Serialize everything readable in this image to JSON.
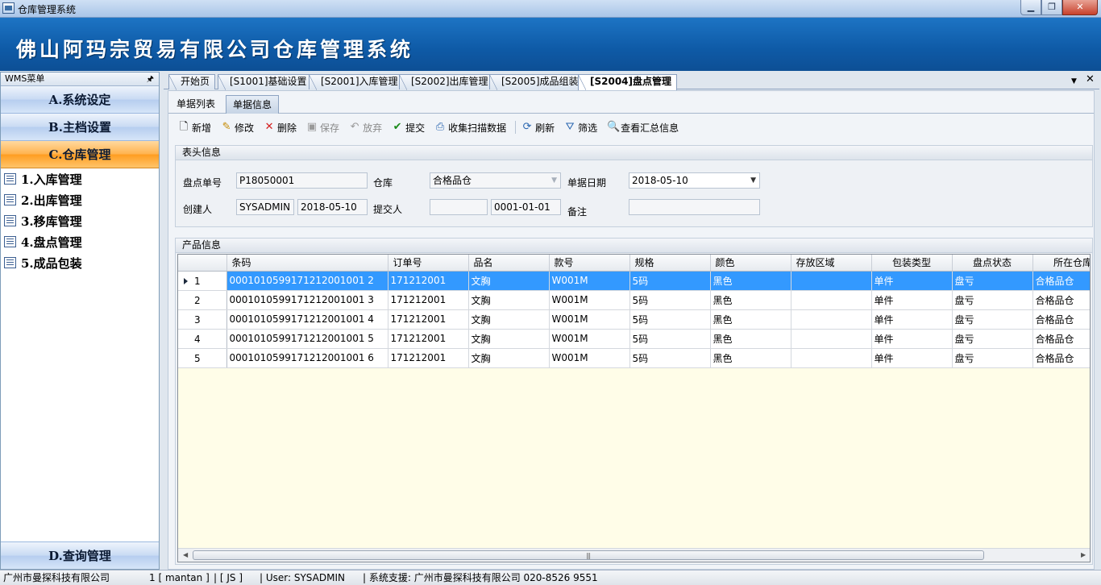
{
  "window": {
    "title": "仓库管理系统"
  },
  "banner": {
    "title": "佛山阿玛宗贸易有限公司仓库管理系统"
  },
  "sidebar": {
    "header": "WMS菜单",
    "groups": [
      {
        "label": "A.系统设定"
      },
      {
        "label": "B.主档设置"
      },
      {
        "label": "C.仓库管理"
      }
    ],
    "items": [
      {
        "label": "1.入库管理"
      },
      {
        "label": "2.出库管理"
      },
      {
        "label": "3.移库管理"
      },
      {
        "label": "4.盘点管理"
      },
      {
        "label": "5.成品包装"
      }
    ],
    "bottom_group": {
      "label": "D.查询管理"
    }
  },
  "doc_tabs": [
    {
      "label": "开始页"
    },
    {
      "label": "[S1001]基础设置"
    },
    {
      "label": "[S2001]入库管理"
    },
    {
      "label": "[S2002]出库管理"
    },
    {
      "label": "[S2005]成品组装"
    },
    {
      "label": "[S2004]盘点管理"
    }
  ],
  "sub_tabs": [
    {
      "label": "单据列表"
    },
    {
      "label": "单据信息"
    }
  ],
  "toolbar": {
    "add": "新增",
    "edit": "修改",
    "delete": "删除",
    "save": "保存",
    "discard": "放弃",
    "submit": "提交",
    "collect_scan": "收集扫描数据",
    "refresh": "刷新",
    "filter": "筛选",
    "summary": "查看汇总信息"
  },
  "header_section": {
    "title": "表头信息",
    "fields": {
      "doc_no_label": "盘点单号",
      "doc_no_value": "P18050001",
      "warehouse_label": "仓库",
      "warehouse_value": "合格品仓",
      "doc_date_label": "单据日期",
      "doc_date_value": "2018-05-10",
      "creator_label": "创建人",
      "creator_value": "SYSADMIN",
      "create_date_value": "2018-05-10",
      "submitter_label": "提交人",
      "submitter_value": "",
      "submit_date_value": "0001-01-01",
      "remark_label": "备注",
      "remark_value": ""
    }
  },
  "product_section": {
    "title": "产品信息",
    "columns": [
      "条码",
      "订单号",
      "品名",
      "款号",
      "规格",
      "颜色",
      "存放区域",
      "包装类型",
      "盘点状态",
      "所在仓库"
    ],
    "rows": [
      {
        "no": "1",
        "cells": [
          "0001010599171212001001 2",
          "171212001",
          "文胸",
          "W001M",
          "5码",
          "黑色",
          "",
          "单件",
          "盘亏",
          "合格品仓"
        ]
      },
      {
        "no": "2",
        "cells": [
          "0001010599171212001001 3",
          "171212001",
          "文胸",
          "W001M",
          "5码",
          "黑色",
          "",
          "单件",
          "盘亏",
          "合格品仓"
        ]
      },
      {
        "no": "3",
        "cells": [
          "0001010599171212001001 4",
          "171212001",
          "文胸",
          "W001M",
          "5码",
          "黑色",
          "",
          "单件",
          "盘亏",
          "合格品仓"
        ]
      },
      {
        "no": "4",
        "cells": [
          "0001010599171212001001 5",
          "171212001",
          "文胸",
          "W001M",
          "5码",
          "黑色",
          "",
          "单件",
          "盘亏",
          "合格品仓"
        ]
      },
      {
        "no": "5",
        "cells": [
          "0001010599171212001001 6",
          "171212001",
          "文胸",
          "W001M",
          "5码",
          "黑色",
          "",
          "单件",
          "盘亏",
          "合格品仓"
        ]
      }
    ]
  },
  "statusbar": {
    "company": "广州市曼探科技有限公司",
    "session": "1 [ mantan ]",
    "code": "| [ JS ]",
    "user": "| User: SYSADMIN",
    "support": "| 系统支援: 广州市曼探科技有限公司 020-8526 9551"
  }
}
